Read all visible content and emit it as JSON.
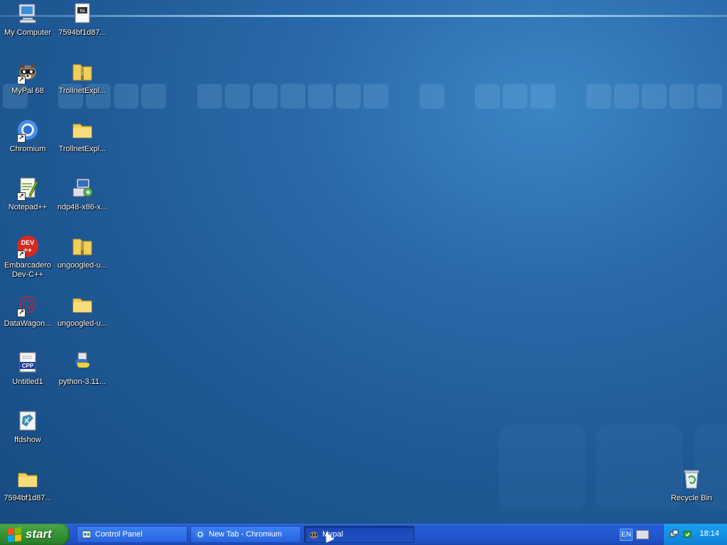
{
  "desktop_icons": [
    {
      "name": "My Computer"
    },
    {
      "name": "7594bf1d87..."
    },
    {
      "name": "MyPal 68"
    },
    {
      "name": "TrollnetExpl..."
    },
    {
      "name": "Chromium"
    },
    {
      "name": "TrollnetExpl..."
    },
    {
      "name": "Notepad++"
    },
    {
      "name": "ndp48-x86-x..."
    },
    {
      "name": "Embarcadero Dev-C++"
    },
    {
      "name": "ungoogled-u..."
    },
    {
      "name": "DataWagon..."
    },
    {
      "name": "ungoogled-u..."
    },
    {
      "name": "Untitled1"
    },
    {
      "name": "python-3.11..."
    },
    {
      "name": "ffdshow"
    },
    {
      "name": "7594bf1d87..."
    },
    {
      "name": "Recycle Bin"
    }
  ],
  "icon_glyphs": {
    "dev_cpp": "DEV\n++",
    "cpp_file": "CPP"
  },
  "taskbar": {
    "start_label": "start",
    "tasks": [
      {
        "label": "Control Panel",
        "state": "inactive"
      },
      {
        "label": "New Tab - Chromium",
        "state": "inactive"
      },
      {
        "label": "Mypal",
        "state": "active"
      }
    ],
    "language": "EN",
    "clock": "18:14"
  },
  "colors": {
    "desktop_bg": "#2a6aaa",
    "taskbar": "#245edb",
    "start_green": "#3c9b3c",
    "tray": "#1591e4"
  }
}
